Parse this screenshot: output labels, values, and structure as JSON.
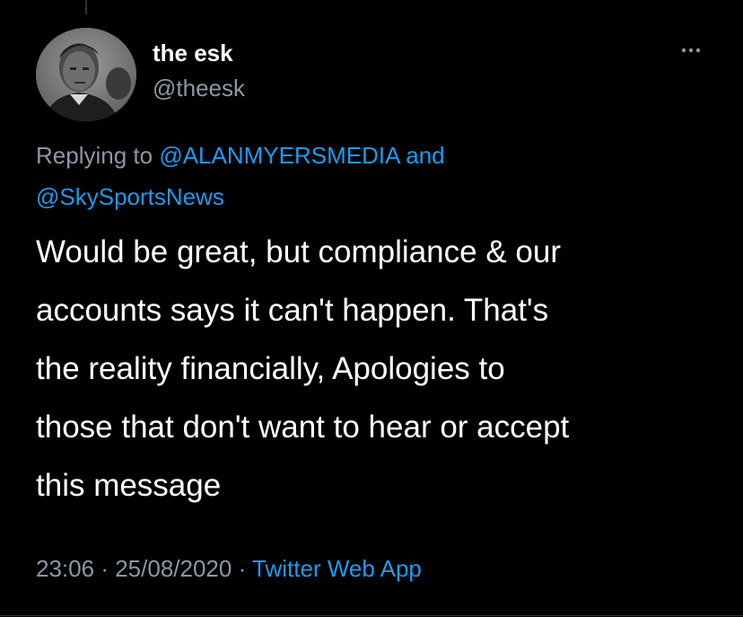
{
  "author": {
    "display_name": "the esk",
    "handle": "@theesk"
  },
  "reply": {
    "prefix": "Replying to",
    "mentions": [
      "@ALANMYERSMEDIA",
      "@SkySportsNews"
    ],
    "joiner": "and"
  },
  "tweet": {
    "lines": [
      "Would be great, but compliance & our",
      "accounts says it can't happen. That's",
      "the reality financially, Apologies to",
      "those that don't want to hear or accept",
      "this message"
    ]
  },
  "meta": {
    "time": "23:06",
    "date": "25/08/2020",
    "separator": "·",
    "source": "Twitter Web App"
  },
  "icons": {
    "more": "more-horizontal-icon"
  },
  "colors": {
    "background": "#000000",
    "text": "#ffffff",
    "secondary": "#8b98a5",
    "link": "#1d9bf0"
  }
}
